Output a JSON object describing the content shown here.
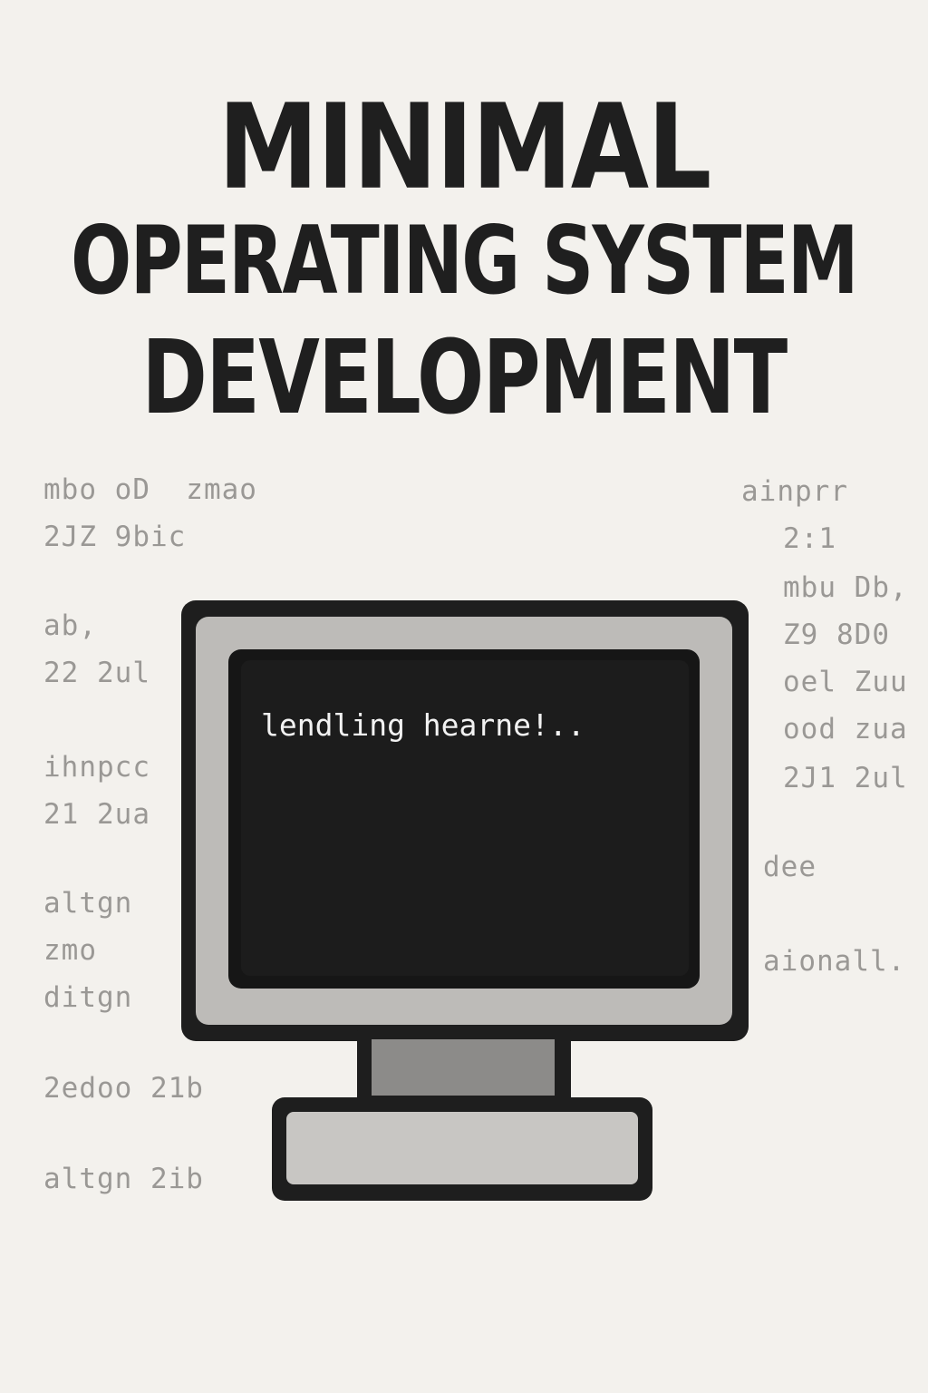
{
  "title": {
    "line1": "MINIMAL",
    "line2": "OPERATING SYSTEM",
    "line3": "DEVELOPMENT"
  },
  "left_code": [
    "mbo oD  zmao",
    "2JZ 9bic",
    "ab,",
    "22 2ul",
    "ihnpcc",
    "21 2ua",
    "altgn",
    "zmo",
    "ditgn",
    "2edoo 21b",
    "altgn 2ib"
  ],
  "right_code": [
    "ainprr",
    "2:1",
    "mbu Db,",
    "Z9 8D0",
    "oel Zuu",
    "ood zua",
    "2J1 2ul",
    "dee",
    "aionall."
  ],
  "screen": {
    "text": "lendling hearne!.."
  },
  "colors": {
    "background": "#f3f1ed",
    "title": "#1f1f1f",
    "code": "#9a9895",
    "monitor_frame": "#1e1e1e",
    "bezel": "#bdbbb8",
    "screen": "#1c1c1c",
    "screen_text": "#f2f2f2"
  },
  "icons": {
    "monitor": "computer-monitor-icon"
  }
}
